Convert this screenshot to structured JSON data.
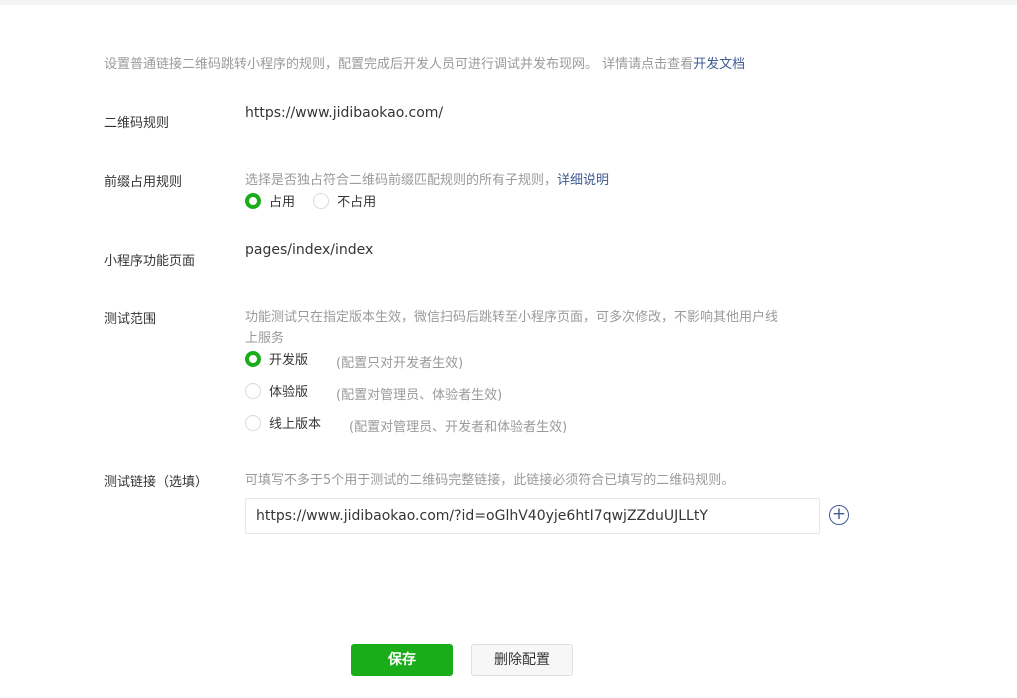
{
  "intro": {
    "text": "设置普通链接二维码跳转小程序的规则，配置完成后开发人员可进行调试并发布现网。 详情请点击查看",
    "link": "开发文档"
  },
  "qr_rule": {
    "label": "二维码规则",
    "value": "https://www.jidibaokao.com/"
  },
  "prefix": {
    "label": "前缀占用规则",
    "desc": "选择是否独占符合二维码前缀匹配规则的所有子规则，",
    "link": "详细说明",
    "options": [
      {
        "label": "占用",
        "checked": true
      },
      {
        "label": "不占用",
        "checked": false
      }
    ]
  },
  "page": {
    "label": "小程序功能页面",
    "value": "pages/index/index"
  },
  "scope": {
    "label": "测试范围",
    "desc1": "功能测试只在指定版本生效，微信扫码后跳转至小程序页面，可多次修改，不影响其他用户线",
    "desc2": "上服务",
    "options": [
      {
        "label": "开发版",
        "note": "(配置只对开发者生效)",
        "checked": true
      },
      {
        "label": "体验版",
        "note": "(配置对管理员、体验者生效)",
        "checked": false
      },
      {
        "label": "线上版本",
        "note": "(配置对管理员、开发者和体验者生效)",
        "checked": false
      }
    ]
  },
  "test_link": {
    "label": "测试链接（选填）",
    "desc": "可填写不多于5个用于测试的二维码完整链接，此链接必须符合已填写的二维码规则。",
    "value": "https://www.jidibaokao.com/?id=oGlhV40yje6htI7qwjZZduUJLLtY",
    "add_icon": "+"
  },
  "buttons": {
    "save": "保存",
    "delete": "删除配置"
  },
  "colors": {
    "accent": "#1aad19",
    "link": "#3f5a93"
  }
}
